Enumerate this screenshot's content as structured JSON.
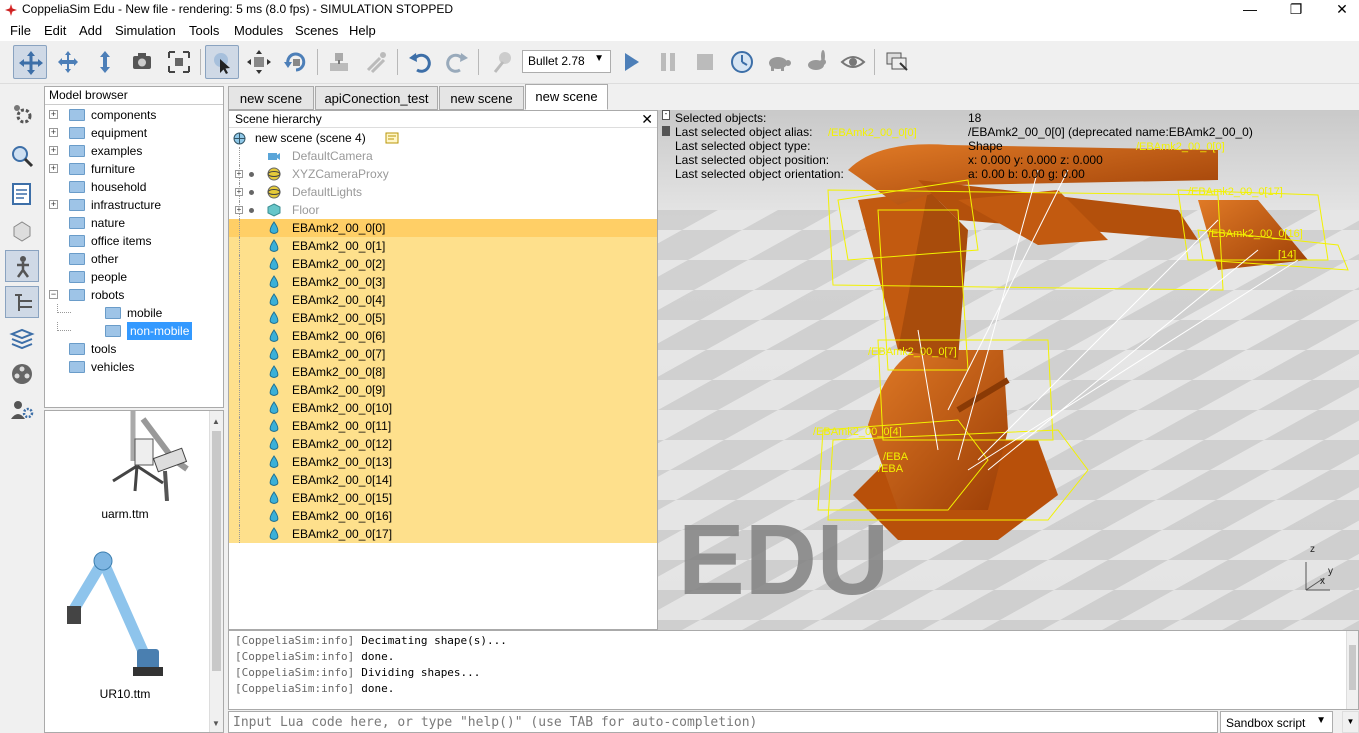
{
  "window": {
    "title": "CoppeliaSim Edu - New file - rendering: 5 ms (8.0 fps) - SIMULATION STOPPED",
    "minimize": "—",
    "maximize": "❐",
    "close": "✕"
  },
  "menu": [
    "File",
    "Edit",
    "Add",
    "Simulation",
    "Tools",
    "Modules",
    "Scenes",
    "Help"
  ],
  "toolbar": {
    "physics_engine": "Bullet 2.78",
    "icons": [
      "camera-pan-icon",
      "camera-rotate-icon",
      "camera-shift-icon",
      "camera-angle-icon",
      "fit-to-view-icon",
      "click-select-icon",
      "object-shift-icon",
      "object-rotate-icon",
      "assemble-icon",
      "transfer-dna-icon",
      "undo-icon",
      "redo-icon",
      "dynamics-toggle-icon",
      "play-icon",
      "pause-icon",
      "stop-icon",
      "realtime-icon",
      "slow-down-icon",
      "speed-up-icon",
      "visualization-toggle-icon",
      "page-selector-icon"
    ]
  },
  "model_browser": {
    "title": "Model browser",
    "items": [
      {
        "label": "components",
        "expandable": true
      },
      {
        "label": "equipment",
        "expandable": true
      },
      {
        "label": "examples",
        "expandable": true
      },
      {
        "label": "furniture",
        "expandable": true
      },
      {
        "label": "household",
        "expandable": false
      },
      {
        "label": "infrastructure",
        "expandable": true
      },
      {
        "label": "nature",
        "expandable": false
      },
      {
        "label": "office items",
        "expandable": false
      },
      {
        "label": "other",
        "expandable": false
      },
      {
        "label": "people",
        "expandable": false
      },
      {
        "label": "robots",
        "expandable": true,
        "expanded": true
      },
      {
        "label": "mobile",
        "child": true
      },
      {
        "label": "non-mobile",
        "child": true,
        "selected": true
      },
      {
        "label": "tools",
        "expandable": false
      },
      {
        "label": "vehicles",
        "expandable": false
      }
    ],
    "thumbnails": [
      {
        "label": "uarm.ttm"
      },
      {
        "label": "UR10.ttm"
      }
    ]
  },
  "scene_tabs": [
    {
      "label": "new scene"
    },
    {
      "label": "apiConection_test"
    },
    {
      "label": "new scene"
    },
    {
      "label": "new scene",
      "active": true
    }
  ],
  "scene_hierarchy": {
    "title": "Scene hierarchy",
    "root": "new scene (scene 4)",
    "objects": [
      {
        "label": "DefaultCamera",
        "dim": true
      },
      {
        "label": "XYZCameraProxy",
        "dim": true
      },
      {
        "label": "DefaultLights",
        "dim": true
      },
      {
        "label": "Floor",
        "dim": true
      },
      {
        "label": "EBAmk2_00_0[0]"
      },
      {
        "label": "EBAmk2_00_0[1]"
      },
      {
        "label": "EBAmk2_00_0[2]"
      },
      {
        "label": "EBAmk2_00_0[3]"
      },
      {
        "label": "EBAmk2_00_0[4]"
      },
      {
        "label": "EBAmk2_00_0[5]"
      },
      {
        "label": "EBAmk2_00_0[6]"
      },
      {
        "label": "EBAmk2_00_0[7]"
      },
      {
        "label": "EBAmk2_00_0[8]"
      },
      {
        "label": "EBAmk2_00_0[9]"
      },
      {
        "label": "EBAmk2_00_0[10]"
      },
      {
        "label": "EBAmk2_00_0[11]"
      },
      {
        "label": "EBAmk2_00_0[12]"
      },
      {
        "label": "EBAmk2_00_0[13]"
      },
      {
        "label": "EBAmk2_00_0[14]"
      },
      {
        "label": "EBAmk2_00_0[15]"
      },
      {
        "label": "EBAmk2_00_0[16]"
      },
      {
        "label": "EBAmk2_00_0[17]"
      }
    ]
  },
  "viewport_info": {
    "rows": [
      {
        "label": "Selected objects:",
        "value": "18"
      },
      {
        "label": "Last selected object alias:",
        "value": "/EBAmk2_00_0[0]   (deprecated name:EBAmk2_00_0)"
      },
      {
        "label": "Last selected object type:",
        "value": "Shape"
      },
      {
        "label": "Last selected object position:",
        "value": "x: 0.000   y: 0.000   z: 0.000"
      },
      {
        "label": "Last selected object orientation:",
        "value": "a: 0.00   b: 0.00   g: 0.00"
      }
    ],
    "watermark": "EDU",
    "axes": {
      "x": "x",
      "y": "y",
      "z": "z"
    },
    "overlay_labels": [
      "/EBAmk2_00_0[0]",
      "/EBAmk2_00_0[17]",
      "/EBAmk2_00_0[16]",
      "/EBAmk2_00_0[14]",
      "/EBAmk2_00_0[7]",
      "/EBAmk2_00_0[4]",
      "/EBA",
      "/EBA"
    ]
  },
  "console": {
    "lines": [
      {
        "prefix": "[CoppeliaSim:info]",
        "text": "Decimating shape(s)..."
      },
      {
        "prefix": "[CoppeliaSim:info]",
        "text": "done."
      },
      {
        "prefix": "[CoppeliaSim:info]",
        "text": "Dividing shapes..."
      },
      {
        "prefix": "[CoppeliaSim:info]",
        "text": "done."
      }
    ],
    "input_placeholder": "Input Lua code here, or type \"help()\" (use TAB for auto-completion)",
    "script_selector": "Sandbox script"
  },
  "colors": {
    "selection_highlight": "#fee08c",
    "last_selection_highlight": "#ffcf66",
    "robot_orange": "#c85a0a",
    "bounding_box": "#f2f200",
    "tree_selected": "#3399ff"
  }
}
